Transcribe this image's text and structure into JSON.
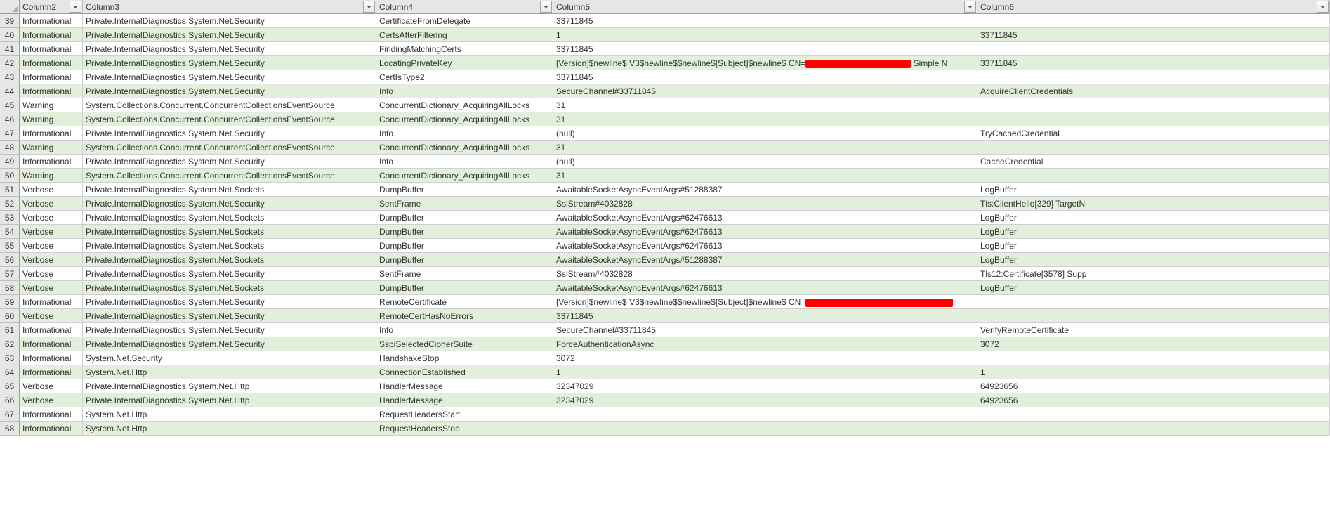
{
  "headers": {
    "c2": "Column2",
    "c3": "Column3",
    "c4": "Column4",
    "c5": "Column5",
    "c6": "Column6"
  },
  "rows": [
    {
      "n": "39",
      "c2": "Informational",
      "c3": "Private.InternalDiagnostics.System.Net.Security",
      "c4": "CertificateFromDelegate",
      "c5": "33711845",
      "c6": ""
    },
    {
      "n": "40",
      "c2": "Informational",
      "c3": "Private.InternalDiagnostics.System.Net.Security",
      "c4": "CertsAfterFiltering",
      "c5": "1",
      "c6": "33711845"
    },
    {
      "n": "41",
      "c2": "Informational",
      "c3": "Private.InternalDiagnostics.System.Net.Security",
      "c4": "FindingMatchingCerts",
      "c5": "33711845",
      "c6": ""
    },
    {
      "n": "42",
      "c2": "Informational",
      "c3": "Private.InternalDiagnostics.System.Net.Security",
      "c4": "LocatingPrivateKey",
      "c5_pre": "[Version]$newline$  V3$newline$$newline$[Subject]$newline$  CN=",
      "c5_redact": "w1",
      "c5_post": "  Simple N",
      "c6": "33711845"
    },
    {
      "n": "43",
      "c2": "Informational",
      "c3": "Private.InternalDiagnostics.System.Net.Security",
      "c4": "CertIsType2",
      "c5": "33711845",
      "c6": ""
    },
    {
      "n": "44",
      "c2": "Informational",
      "c3": "Private.InternalDiagnostics.System.Net.Security",
      "c4": "Info",
      "c5": "SecureChannel#33711845",
      "c6": "AcquireClientCredentials"
    },
    {
      "n": "45",
      "c2": "Warning",
      "c3": "System.Collections.Concurrent.ConcurrentCollectionsEventSource",
      "c4": "ConcurrentDictionary_AcquiringAllLocks",
      "c5": "31",
      "c6": ""
    },
    {
      "n": "46",
      "c2": "Warning",
      "c3": "System.Collections.Concurrent.ConcurrentCollectionsEventSource",
      "c4": "ConcurrentDictionary_AcquiringAllLocks",
      "c5": "31",
      "c6": ""
    },
    {
      "n": "47",
      "c2": "Informational",
      "c3": "Private.InternalDiagnostics.System.Net.Security",
      "c4": "Info",
      "c5": "(null)",
      "c6": "TryCachedCredential"
    },
    {
      "n": "48",
      "c2": "Warning",
      "c3": "System.Collections.Concurrent.ConcurrentCollectionsEventSource",
      "c4": "ConcurrentDictionary_AcquiringAllLocks",
      "c5": "31",
      "c6": ""
    },
    {
      "n": "49",
      "c2": "Informational",
      "c3": "Private.InternalDiagnostics.System.Net.Security",
      "c4": "Info",
      "c5": "(null)",
      "c6": "CacheCredential"
    },
    {
      "n": "50",
      "c2": "Warning",
      "c3": "System.Collections.Concurrent.ConcurrentCollectionsEventSource",
      "c4": "ConcurrentDictionary_AcquiringAllLocks",
      "c5": "31",
      "c6": ""
    },
    {
      "n": "51",
      "c2": "Verbose",
      "c3": "Private.InternalDiagnostics.System.Net.Sockets",
      "c4": "DumpBuffer",
      "c5": "AwaitableSocketAsyncEventArgs#51288387",
      "c6": "LogBuffer"
    },
    {
      "n": "52",
      "c2": "Verbose",
      "c3": "Private.InternalDiagnostics.System.Net.Security",
      "c4": "SentFrame",
      "c5": "SslStream#4032828",
      "c6": "Tls:ClientHello[329] TargetN"
    },
    {
      "n": "53",
      "c2": "Verbose",
      "c3": "Private.InternalDiagnostics.System.Net.Sockets",
      "c4": "DumpBuffer",
      "c5": "AwaitableSocketAsyncEventArgs#62476613",
      "c6": "LogBuffer"
    },
    {
      "n": "54",
      "c2": "Verbose",
      "c3": "Private.InternalDiagnostics.System.Net.Sockets",
      "c4": "DumpBuffer",
      "c5": "AwaitableSocketAsyncEventArgs#62476613",
      "c6": "LogBuffer"
    },
    {
      "n": "55",
      "c2": "Verbose",
      "c3": "Private.InternalDiagnostics.System.Net.Sockets",
      "c4": "DumpBuffer",
      "c5": "AwaitableSocketAsyncEventArgs#62476613",
      "c6": "LogBuffer"
    },
    {
      "n": "56",
      "c2": "Verbose",
      "c3": "Private.InternalDiagnostics.System.Net.Sockets",
      "c4": "DumpBuffer",
      "c5": "AwaitableSocketAsyncEventArgs#51288387",
      "c6": "LogBuffer"
    },
    {
      "n": "57",
      "c2": "Verbose",
      "c3": "Private.InternalDiagnostics.System.Net.Security",
      "c4": "SentFrame",
      "c5": "SslStream#4032828",
      "c6": "Tls12:Certificate[3578] Supp"
    },
    {
      "n": "58",
      "c2": "Verbose",
      "c3": "Private.InternalDiagnostics.System.Net.Sockets",
      "c4": "DumpBuffer",
      "c5": "AwaitableSocketAsyncEventArgs#62476613",
      "c6": "LogBuffer"
    },
    {
      "n": "59",
      "c2": "Informational",
      "c3": "Private.InternalDiagnostics.System.Net.Security",
      "c4": "RemoteCertificate",
      "c5_pre": "[Version]$newline$  V3$newline$$newline$[Subject]$newline$  CN=",
      "c5_redact": "w2",
      "c5_post": "",
      "c6": ""
    },
    {
      "n": "60",
      "c2": "Verbose",
      "c3": "Private.InternalDiagnostics.System.Net.Security",
      "c4": "RemoteCertHasNoErrors",
      "c5": "33711845",
      "c6": ""
    },
    {
      "n": "61",
      "c2": "Informational",
      "c3": "Private.InternalDiagnostics.System.Net.Security",
      "c4": "Info",
      "c5": "SecureChannel#33711845",
      "c6": "VerifyRemoteCertificate"
    },
    {
      "n": "62",
      "c2": "Informational",
      "c3": "Private.InternalDiagnostics.System.Net.Security",
      "c4": "SspiSelectedCipherSuite",
      "c5": "ForceAuthenticationAsync",
      "c6": "3072"
    },
    {
      "n": "63",
      "c2": "Informational",
      "c3": "System.Net.Security",
      "c4": "HandshakeStop",
      "c5": "3072",
      "c6": ""
    },
    {
      "n": "64",
      "c2": "Informational",
      "c3": "System.Net.Http",
      "c4": "ConnectionEstablished",
      "c5": "1",
      "c6": "1"
    },
    {
      "n": "65",
      "c2": "Verbose",
      "c3": "Private.InternalDiagnostics.System.Net.Http",
      "c4": "HandlerMessage",
      "c5": "32347029",
      "c6": "64923656"
    },
    {
      "n": "66",
      "c2": "Verbose",
      "c3": "Private.InternalDiagnostics.System.Net.Http",
      "c4": "HandlerMessage",
      "c5": "32347029",
      "c6": "64923656"
    },
    {
      "n": "67",
      "c2": "Informational",
      "c3": "System.Net.Http",
      "c4": "RequestHeadersStart",
      "c5": "",
      "c6": ""
    },
    {
      "n": "68",
      "c2": "Informational",
      "c3": "System.Net.Http",
      "c4": "RequestHeadersStop",
      "c5": "",
      "c6": ""
    }
  ]
}
